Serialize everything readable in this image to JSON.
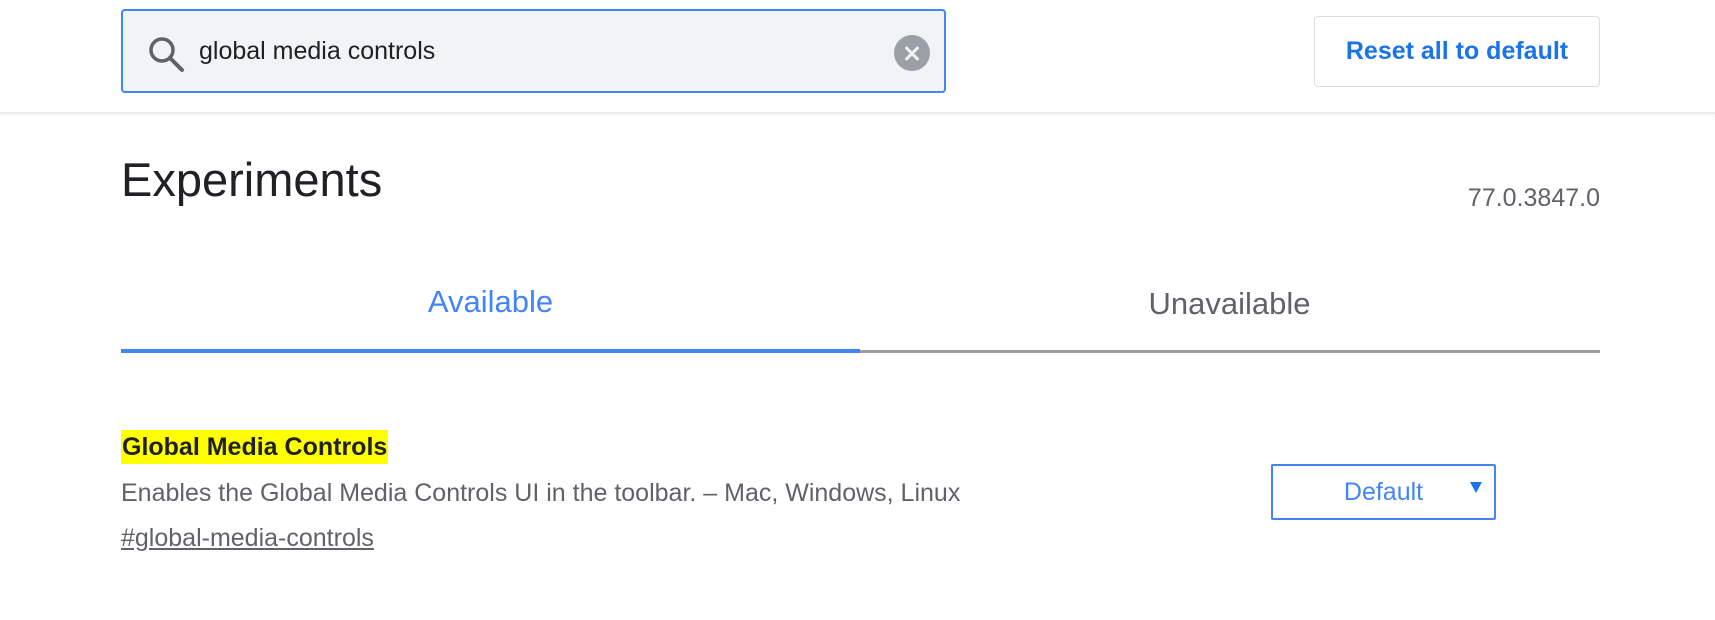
{
  "search": {
    "value": "global media controls",
    "icon": "search-icon",
    "clear_icon": "close-circle-icon"
  },
  "header": {
    "reset_label": "Reset all to default"
  },
  "page": {
    "title": "Experiments",
    "version": "77.0.3847.0"
  },
  "tabs": [
    {
      "label": "Available",
      "active": true
    },
    {
      "label": "Unavailable",
      "active": false
    }
  ],
  "experiments": [
    {
      "title": "Global Media Controls",
      "description": "Enables the Global Media Controls UI in the toolbar. – Mac, Windows, Linux",
      "link": "#global-media-controls",
      "selected_option": "Default"
    }
  ],
  "colors": {
    "accent": "#4285f4",
    "highlight": "#ffff00",
    "text_secondary": "#5f6368"
  }
}
